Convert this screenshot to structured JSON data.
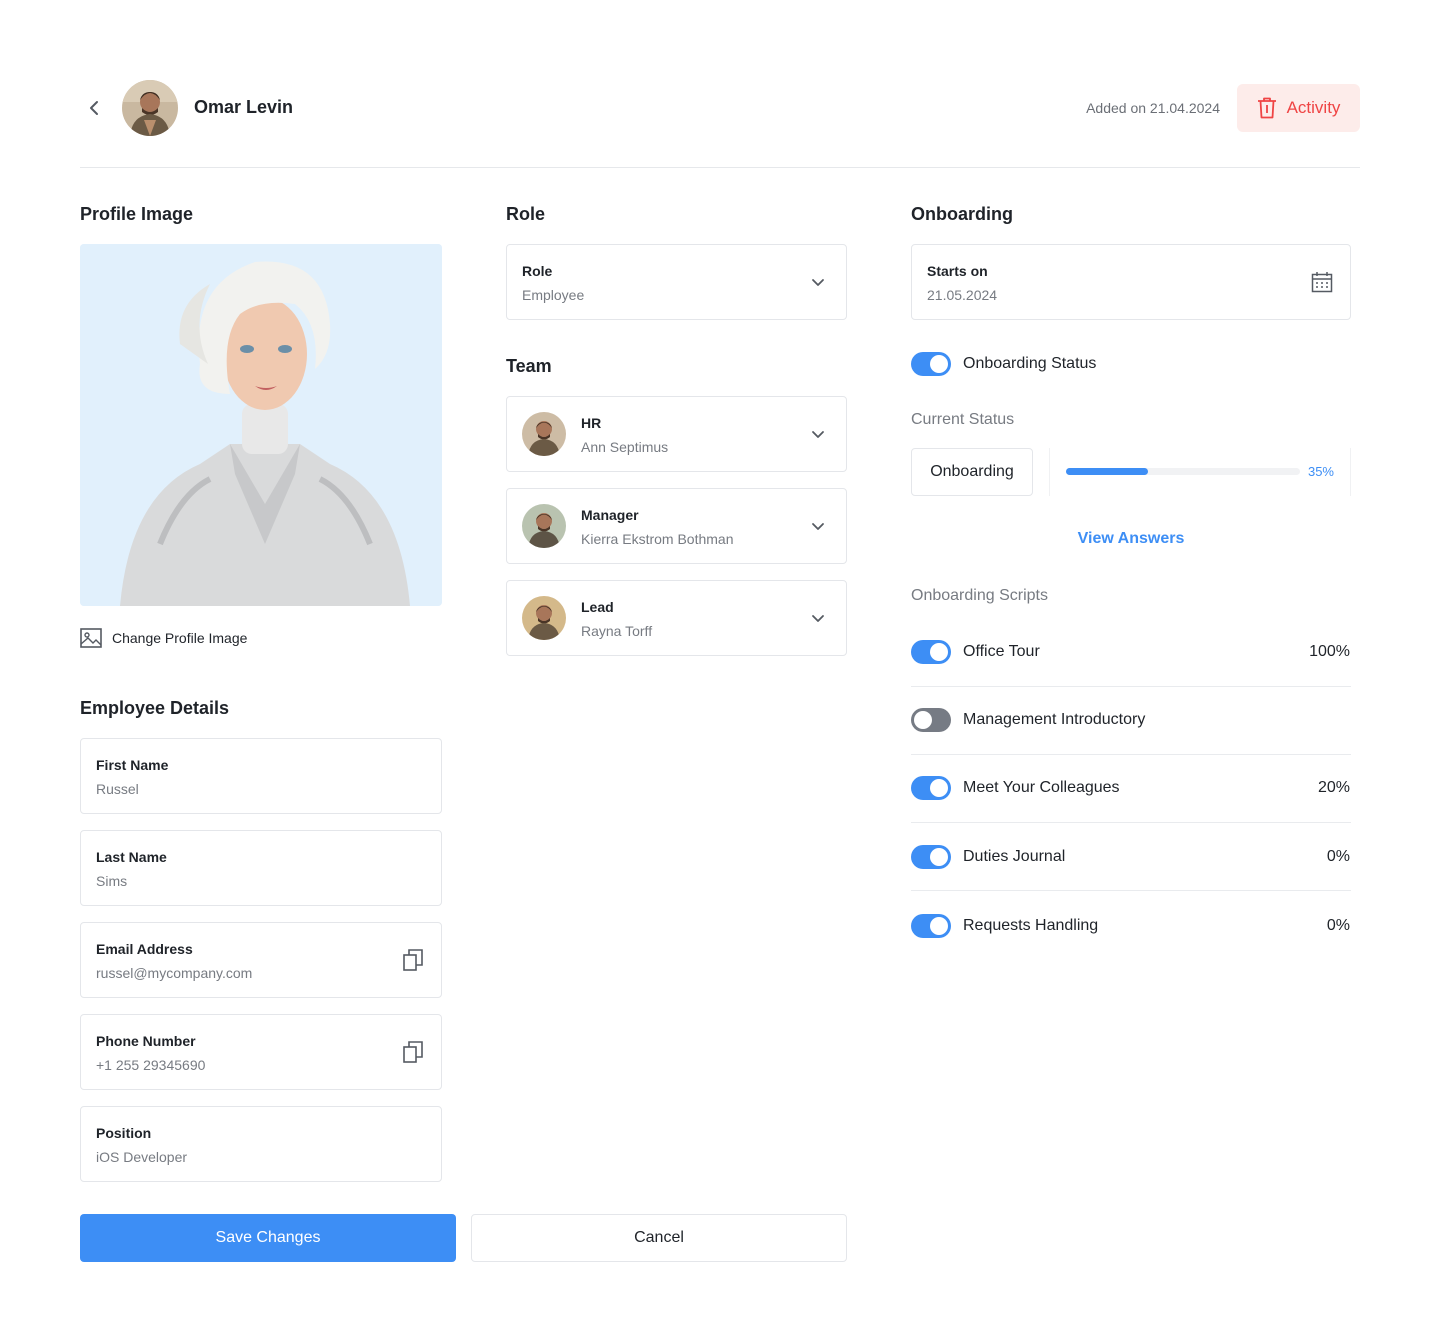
{
  "header": {
    "name": "Omar Levin",
    "added_on": "Added on 21.04.2024",
    "activity_label": "Activity"
  },
  "profile": {
    "title": "Profile Image",
    "change_label": "Change Profile Image"
  },
  "employee": {
    "title": "Employee Details",
    "fields": [
      {
        "label": "First Name",
        "value": "Russel"
      },
      {
        "label": "Last Name",
        "value": "Sims"
      },
      {
        "label": "Email Address",
        "value": "russel@mycompany.com"
      },
      {
        "label": "Phone Number",
        "value": "+1 255 29345690"
      },
      {
        "label": "Position",
        "value": "iOS Developer"
      }
    ]
  },
  "role": {
    "title": "Role",
    "label": "Role",
    "value": "Employee"
  },
  "team": {
    "title": "Team",
    "members": [
      {
        "label": "HR",
        "value": "Ann Septimus"
      },
      {
        "label": "Manager",
        "value": "Kierra Ekstrom Bothman"
      },
      {
        "label": "Lead",
        "value": "Rayna Torff"
      }
    ]
  },
  "onboarding": {
    "title": "Onboarding",
    "starts_label": "Starts on",
    "starts_value": "21.05.2024",
    "status_toggle_label": "Onboarding Status",
    "status_toggle_on": true,
    "current_status_title": "Current Status",
    "current_status": "Onboarding",
    "progress": 0.35,
    "progress_label": "35%",
    "view_answers": "View Answers",
    "scripts_title": "Onboarding Scripts",
    "scripts": [
      {
        "label": "Office Tour",
        "on": true,
        "pct": "100%"
      },
      {
        "label": "Management Introductory",
        "on": false,
        "pct": ""
      },
      {
        "label": "Meet Your Colleagues",
        "on": true,
        "pct": "20%"
      },
      {
        "label": "Duties Journal",
        "on": true,
        "pct": "0%"
      },
      {
        "label": "Requests Handling",
        "on": true,
        "pct": "0%"
      }
    ]
  },
  "actions": {
    "save": "Save Changes",
    "cancel": "Cancel"
  },
  "colors": {
    "accent": "#3d8ef5",
    "danger": "#ef4444",
    "danger_bg": "#fdecea",
    "toggle_off": "#767b84"
  }
}
